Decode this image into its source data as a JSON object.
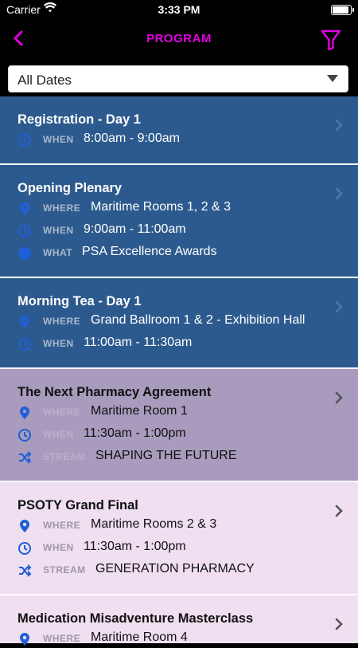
{
  "status_bar": {
    "carrier": "Carrier",
    "time": "3:33 PM"
  },
  "nav": {
    "title": "PROGRAM",
    "back_icon": "chevron-left-icon",
    "filter_icon": "filter-icon"
  },
  "date_filter": {
    "selected": "All Dates"
  },
  "colors": {
    "accent": "#e100e1",
    "session_blue": "#2d5a8e",
    "session_purple": "#a89bbd",
    "session_pink": "#efdff0",
    "icon_blue": "#1f5fd8"
  },
  "sessions": [
    {
      "title": "Registration - Day 1",
      "rows": [
        {
          "icon": "clock-icon",
          "label": "WHEN",
          "value": "8:00am - 9:00am"
        }
      ]
    },
    {
      "title": "Opening Plenary",
      "rows": [
        {
          "icon": "location-pin-icon",
          "label": "WHERE",
          "value": "Maritime Rooms 1, 2 & 3"
        },
        {
          "icon": "clock-icon",
          "label": "WHEN",
          "value": "9:00am - 11:00am"
        },
        {
          "icon": "info-icon",
          "label": "WHAT",
          "value": "PSA Excellence Awards"
        }
      ]
    },
    {
      "title": "Morning Tea - Day 1",
      "rows": [
        {
          "icon": "location-pin-icon",
          "label": "WHERE",
          "value": "Grand Ballroom 1 & 2 - Exhibition Hall"
        },
        {
          "icon": "clock-icon",
          "label": "WHEN",
          "value": "11:00am - 11:30am"
        }
      ]
    },
    {
      "title": "The Next Pharmacy Agreement",
      "rows": [
        {
          "icon": "location-pin-icon",
          "label": "WHERE",
          "value": "Maritime Room 1"
        },
        {
          "icon": "clock-icon",
          "label": "WHEN",
          "value": "11:30am - 1:00pm"
        },
        {
          "icon": "shuffle-icon",
          "label": "STREAM",
          "value": "SHAPING THE FUTURE"
        }
      ]
    },
    {
      "title": "PSOTY Grand Final",
      "rows": [
        {
          "icon": "location-pin-icon",
          "label": "WHERE",
          "value": "Maritime Rooms 2 & 3"
        },
        {
          "icon": "clock-icon",
          "label": "WHEN",
          "value": "11:30am - 1:00pm"
        },
        {
          "icon": "shuffle-icon",
          "label": "STREAM",
          "value": "GENERATION PHARMACY"
        }
      ]
    },
    {
      "title": "Medication Misadventure Masterclass",
      "rows": [
        {
          "icon": "location-pin-icon",
          "label": "WHERE",
          "value": "Maritime Room 4"
        }
      ]
    }
  ]
}
